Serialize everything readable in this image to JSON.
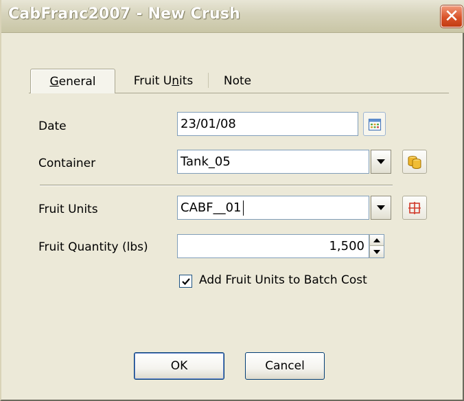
{
  "window": {
    "title": "CabFranc2007 - New Crush",
    "close_label": "✕"
  },
  "tabs": [
    {
      "label_pre": "",
      "label_u": "G",
      "label_post": "eneral",
      "active": true
    },
    {
      "label_pre": "Fruit U",
      "label_u": "n",
      "label_post": "its",
      "active": false
    },
    {
      "label_pre": "Note",
      "label_u": "",
      "label_post": "",
      "active": false
    }
  ],
  "form": {
    "date_label": "Date",
    "date_value": "23/01/08",
    "container_label": "Container",
    "container_value": "Tank_05",
    "fruit_units_label": "Fruit Units",
    "fruit_units_value": "CABF__01",
    "fruit_quantity_label": "Fruit Quantity (lbs)",
    "fruit_quantity_value": "1,500",
    "batch_cost_label": "Add Fruit Units to Batch Cost",
    "batch_cost_checked": true
  },
  "buttons": {
    "ok_label": "OK",
    "cancel_label": "Cancel"
  },
  "icons": {
    "calendar": "calendar-icon",
    "container": "container-barrels-icon",
    "fruit_units": "grid-icon",
    "close": "close-icon"
  },
  "colors": {
    "close_button": "#d9532a",
    "dialog_bg": "#ece9d8",
    "field_border": "#7f9db9",
    "accent_orange": "#e0a21b"
  }
}
